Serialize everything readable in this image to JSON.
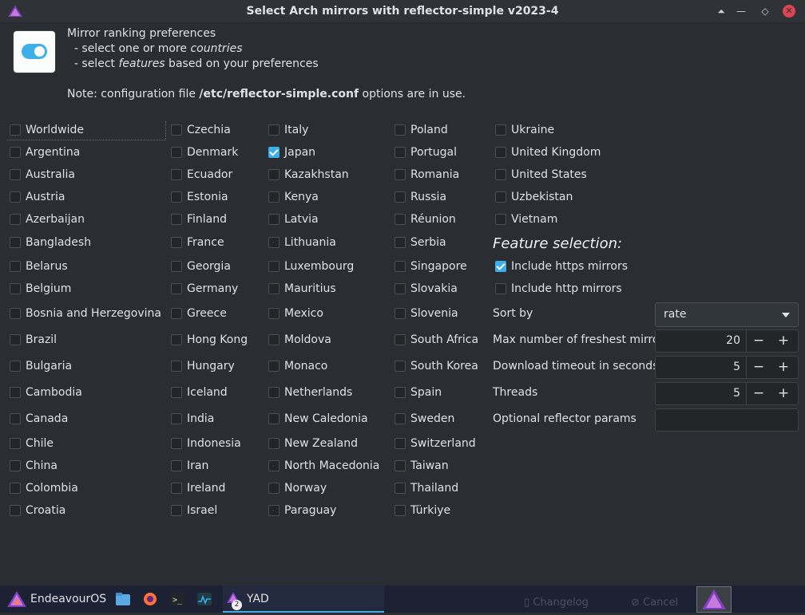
{
  "window": {
    "title": "Select Arch mirrors with reflector-simple v2023-4",
    "controls": [
      "keep-above",
      "minimize",
      "restore",
      "close"
    ]
  },
  "header": {
    "line1": "Mirror ranking preferences",
    "line2_prefix": "  - select one or more ",
    "line2_em": "countries",
    "line3_prefix": "  - select ",
    "line3_em": "features",
    "line3_suffix": " based on your preferences",
    "note_prefix": "Note: configuration file ",
    "note_path": "/etc/reflector-simple.conf",
    "note_suffix": " options are in use."
  },
  "countries": {
    "col1": [
      {
        "label": "Worldwide",
        "checked": false
      },
      {
        "label": "Argentina",
        "checked": false
      },
      {
        "label": "Australia",
        "checked": false
      },
      {
        "label": "Austria",
        "checked": false
      },
      {
        "label": "Azerbaijan",
        "checked": false
      },
      {
        "label": "Bangladesh",
        "checked": false
      },
      {
        "label": "Belarus",
        "checked": false
      },
      {
        "label": "Belgium",
        "checked": false
      },
      {
        "label": "Bosnia and Herzegovina",
        "checked": false
      },
      {
        "label": "Brazil",
        "checked": false
      },
      {
        "label": "Bulgaria",
        "checked": false
      },
      {
        "label": "Cambodia",
        "checked": false
      },
      {
        "label": "Canada",
        "checked": false
      },
      {
        "label": "Chile",
        "checked": false
      },
      {
        "label": "China",
        "checked": false
      },
      {
        "label": "Colombia",
        "checked": false
      },
      {
        "label": "Croatia",
        "checked": false
      }
    ],
    "col2": [
      {
        "label": "Czechia",
        "checked": false
      },
      {
        "label": "Denmark",
        "checked": false
      },
      {
        "label": "Ecuador",
        "checked": false
      },
      {
        "label": "Estonia",
        "checked": false
      },
      {
        "label": "Finland",
        "checked": false
      },
      {
        "label": "France",
        "checked": false
      },
      {
        "label": "Georgia",
        "checked": false
      },
      {
        "label": "Germany",
        "checked": false
      },
      {
        "label": "Greece",
        "checked": false
      },
      {
        "label": "Hong Kong",
        "checked": false
      },
      {
        "label": "Hungary",
        "checked": false
      },
      {
        "label": "Iceland",
        "checked": false
      },
      {
        "label": "India",
        "checked": false
      },
      {
        "label": "Indonesia",
        "checked": false
      },
      {
        "label": "Iran",
        "checked": false
      },
      {
        "label": "Ireland",
        "checked": false
      },
      {
        "label": "Israel",
        "checked": false
      }
    ],
    "col3": [
      {
        "label": "Italy",
        "checked": false
      },
      {
        "label": "Japan",
        "checked": true
      },
      {
        "label": "Kazakhstan",
        "checked": false
      },
      {
        "label": "Kenya",
        "checked": false
      },
      {
        "label": "Latvia",
        "checked": false
      },
      {
        "label": "Lithuania",
        "checked": false
      },
      {
        "label": "Luxembourg",
        "checked": false
      },
      {
        "label": "Mauritius",
        "checked": false
      },
      {
        "label": "Mexico",
        "checked": false
      },
      {
        "label": "Moldova",
        "checked": false
      },
      {
        "label": "Monaco",
        "checked": false
      },
      {
        "label": "Netherlands",
        "checked": false
      },
      {
        "label": "New Caledonia",
        "checked": false
      },
      {
        "label": "New Zealand",
        "checked": false
      },
      {
        "label": "North Macedonia",
        "checked": false
      },
      {
        "label": "Norway",
        "checked": false
      },
      {
        "label": "Paraguay",
        "checked": false
      }
    ],
    "col4": [
      {
        "label": "Poland",
        "checked": false
      },
      {
        "label": "Portugal",
        "checked": false
      },
      {
        "label": "Romania",
        "checked": false
      },
      {
        "label": "Russia",
        "checked": false
      },
      {
        "label": "Réunion",
        "checked": false
      },
      {
        "label": "Serbia",
        "checked": false
      },
      {
        "label": "Singapore",
        "checked": false
      },
      {
        "label": "Slovakia",
        "checked": false
      },
      {
        "label": "Slovenia",
        "checked": false
      },
      {
        "label": "South Africa",
        "checked": false
      },
      {
        "label": "South Korea",
        "checked": false
      },
      {
        "label": "Spain",
        "checked": false
      },
      {
        "label": "Sweden",
        "checked": false
      },
      {
        "label": "Switzerland",
        "checked": false
      },
      {
        "label": "Taiwan",
        "checked": false
      },
      {
        "label": "Thailand",
        "checked": false
      },
      {
        "label": "Türkiye",
        "checked": false
      }
    ],
    "col5": [
      {
        "label": "Ukraine",
        "checked": false
      },
      {
        "label": "United Kingdom",
        "checked": false
      },
      {
        "label": "United States",
        "checked": false
      },
      {
        "label": "Uzbekistan",
        "checked": false
      },
      {
        "label": "Vietnam",
        "checked": false
      }
    ]
  },
  "features": {
    "title": "Feature selection:",
    "https": {
      "label": "Include https mirrors",
      "checked": true
    },
    "http": {
      "label": "Include http mirrors",
      "checked": false
    },
    "sort_by": {
      "label": "Sort by",
      "value": "rate"
    },
    "max_mirrors": {
      "label": "Max number of freshest mirrors",
      "value": "20"
    },
    "timeout": {
      "label": "Download timeout in seconds",
      "value": "5"
    },
    "threads": {
      "label": "Threads",
      "value": "5"
    },
    "params": {
      "label": "Optional reflector params",
      "value": ""
    },
    "minus": "−",
    "plus": "+"
  },
  "taskbar": {
    "start_label": "EndeavourOS",
    "active_task": "YAD",
    "badge": "2",
    "ghost1": "Changelog",
    "ghost2": "Cancel"
  },
  "colors": {
    "accent": "#3daee9",
    "window_bg": "#2a2e32",
    "taskbar_bg": "#1c2134",
    "close": "#da4453"
  }
}
